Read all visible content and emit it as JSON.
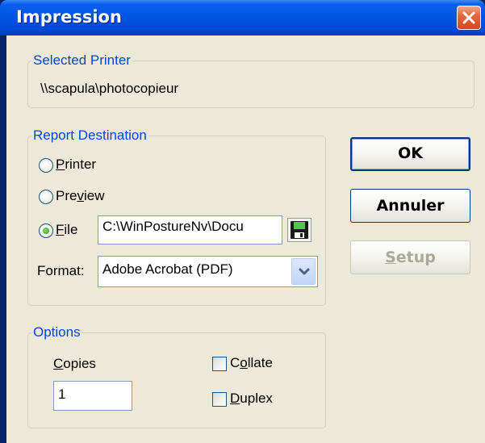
{
  "window": {
    "title": "Impression"
  },
  "selected_printer": {
    "legend": "Selected Printer",
    "value": "\\\\scapula\\photocopieur"
  },
  "report_destination": {
    "legend": "Report Destination",
    "options": [
      {
        "pre": "",
        "mnemonic": "P",
        "post": "rinter",
        "checked": false
      },
      {
        "pre": "Pre",
        "mnemonic": "v",
        "post": "iew",
        "checked": false
      },
      {
        "pre": "",
        "mnemonic": "F",
        "post": "ile",
        "checked": true
      }
    ],
    "file_path": "C:\\WinPostureNv\\Docu",
    "format_label": "Format:",
    "format_value": "Adobe Acrobat (PDF)"
  },
  "options": {
    "legend": "Options",
    "copies_label_mnemonic": "C",
    "copies_label_rest": "opies",
    "copies_value": "1",
    "collate": {
      "pre": "C",
      "mnemonic": "o",
      "post": "llate",
      "checked": false
    },
    "duplex": {
      "pre": "",
      "mnemonic": "D",
      "post": "uplex",
      "checked": false
    }
  },
  "buttons": {
    "ok": "OK",
    "cancel": "Annuler",
    "setup_mnemonic": "S",
    "setup_rest": "etup"
  },
  "icons": [
    "close-icon",
    "floppy-disk-icon",
    "chevron-down-icon"
  ],
  "colors": {
    "title_bar": "#0054e3",
    "group_legend": "#0046d5",
    "client_bg": "#ece9d8"
  }
}
